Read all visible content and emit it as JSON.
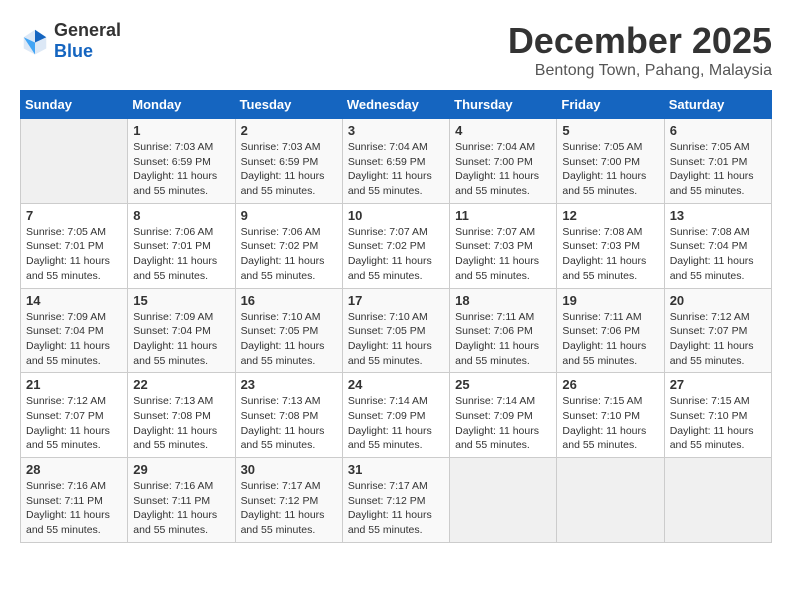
{
  "logo": {
    "text_general": "General",
    "text_blue": "Blue"
  },
  "title": "December 2025",
  "subtitle": "Bentong Town, Pahang, Malaysia",
  "header": {
    "days": [
      "Sunday",
      "Monday",
      "Tuesday",
      "Wednesday",
      "Thursday",
      "Friday",
      "Saturday"
    ]
  },
  "weeks": [
    {
      "days": [
        {
          "num": "",
          "empty": true
        },
        {
          "num": "1",
          "sunrise": "Sunrise: 7:03 AM",
          "sunset": "Sunset: 6:59 PM",
          "daylight": "Daylight: 11 hours and 55 minutes."
        },
        {
          "num": "2",
          "sunrise": "Sunrise: 7:03 AM",
          "sunset": "Sunset: 6:59 PM",
          "daylight": "Daylight: 11 hours and 55 minutes."
        },
        {
          "num": "3",
          "sunrise": "Sunrise: 7:04 AM",
          "sunset": "Sunset: 6:59 PM",
          "daylight": "Daylight: 11 hours and 55 minutes."
        },
        {
          "num": "4",
          "sunrise": "Sunrise: 7:04 AM",
          "sunset": "Sunset: 7:00 PM",
          "daylight": "Daylight: 11 hours and 55 minutes."
        },
        {
          "num": "5",
          "sunrise": "Sunrise: 7:05 AM",
          "sunset": "Sunset: 7:00 PM",
          "daylight": "Daylight: 11 hours and 55 minutes."
        },
        {
          "num": "6",
          "sunrise": "Sunrise: 7:05 AM",
          "sunset": "Sunset: 7:01 PM",
          "daylight": "Daylight: 11 hours and 55 minutes."
        }
      ]
    },
    {
      "days": [
        {
          "num": "7",
          "sunrise": "Sunrise: 7:05 AM",
          "sunset": "Sunset: 7:01 PM",
          "daylight": "Daylight: 11 hours and 55 minutes."
        },
        {
          "num": "8",
          "sunrise": "Sunrise: 7:06 AM",
          "sunset": "Sunset: 7:01 PM",
          "daylight": "Daylight: 11 hours and 55 minutes."
        },
        {
          "num": "9",
          "sunrise": "Sunrise: 7:06 AM",
          "sunset": "Sunset: 7:02 PM",
          "daylight": "Daylight: 11 hours and 55 minutes."
        },
        {
          "num": "10",
          "sunrise": "Sunrise: 7:07 AM",
          "sunset": "Sunset: 7:02 PM",
          "daylight": "Daylight: 11 hours and 55 minutes."
        },
        {
          "num": "11",
          "sunrise": "Sunrise: 7:07 AM",
          "sunset": "Sunset: 7:03 PM",
          "daylight": "Daylight: 11 hours and 55 minutes."
        },
        {
          "num": "12",
          "sunrise": "Sunrise: 7:08 AM",
          "sunset": "Sunset: 7:03 PM",
          "daylight": "Daylight: 11 hours and 55 minutes."
        },
        {
          "num": "13",
          "sunrise": "Sunrise: 7:08 AM",
          "sunset": "Sunset: 7:04 PM",
          "daylight": "Daylight: 11 hours and 55 minutes."
        }
      ]
    },
    {
      "days": [
        {
          "num": "14",
          "sunrise": "Sunrise: 7:09 AM",
          "sunset": "Sunset: 7:04 PM",
          "daylight": "Daylight: 11 hours and 55 minutes."
        },
        {
          "num": "15",
          "sunrise": "Sunrise: 7:09 AM",
          "sunset": "Sunset: 7:04 PM",
          "daylight": "Daylight: 11 hours and 55 minutes."
        },
        {
          "num": "16",
          "sunrise": "Sunrise: 7:10 AM",
          "sunset": "Sunset: 7:05 PM",
          "daylight": "Daylight: 11 hours and 55 minutes."
        },
        {
          "num": "17",
          "sunrise": "Sunrise: 7:10 AM",
          "sunset": "Sunset: 7:05 PM",
          "daylight": "Daylight: 11 hours and 55 minutes."
        },
        {
          "num": "18",
          "sunrise": "Sunrise: 7:11 AM",
          "sunset": "Sunset: 7:06 PM",
          "daylight": "Daylight: 11 hours and 55 minutes."
        },
        {
          "num": "19",
          "sunrise": "Sunrise: 7:11 AM",
          "sunset": "Sunset: 7:06 PM",
          "daylight": "Daylight: 11 hours and 55 minutes."
        },
        {
          "num": "20",
          "sunrise": "Sunrise: 7:12 AM",
          "sunset": "Sunset: 7:07 PM",
          "daylight": "Daylight: 11 hours and 55 minutes."
        }
      ]
    },
    {
      "days": [
        {
          "num": "21",
          "sunrise": "Sunrise: 7:12 AM",
          "sunset": "Sunset: 7:07 PM",
          "daylight": "Daylight: 11 hours and 55 minutes."
        },
        {
          "num": "22",
          "sunrise": "Sunrise: 7:13 AM",
          "sunset": "Sunset: 7:08 PM",
          "daylight": "Daylight: 11 hours and 55 minutes."
        },
        {
          "num": "23",
          "sunrise": "Sunrise: 7:13 AM",
          "sunset": "Sunset: 7:08 PM",
          "daylight": "Daylight: 11 hours and 55 minutes."
        },
        {
          "num": "24",
          "sunrise": "Sunrise: 7:14 AM",
          "sunset": "Sunset: 7:09 PM",
          "daylight": "Daylight: 11 hours and 55 minutes."
        },
        {
          "num": "25",
          "sunrise": "Sunrise: 7:14 AM",
          "sunset": "Sunset: 7:09 PM",
          "daylight": "Daylight: 11 hours and 55 minutes."
        },
        {
          "num": "26",
          "sunrise": "Sunrise: 7:15 AM",
          "sunset": "Sunset: 7:10 PM",
          "daylight": "Daylight: 11 hours and 55 minutes."
        },
        {
          "num": "27",
          "sunrise": "Sunrise: 7:15 AM",
          "sunset": "Sunset: 7:10 PM",
          "daylight": "Daylight: 11 hours and 55 minutes."
        }
      ]
    },
    {
      "days": [
        {
          "num": "28",
          "sunrise": "Sunrise: 7:16 AM",
          "sunset": "Sunset: 7:11 PM",
          "daylight": "Daylight: 11 hours and 55 minutes."
        },
        {
          "num": "29",
          "sunrise": "Sunrise: 7:16 AM",
          "sunset": "Sunset: 7:11 PM",
          "daylight": "Daylight: 11 hours and 55 minutes."
        },
        {
          "num": "30",
          "sunrise": "Sunrise: 7:17 AM",
          "sunset": "Sunset: 7:12 PM",
          "daylight": "Daylight: 11 hours and 55 minutes."
        },
        {
          "num": "31",
          "sunrise": "Sunrise: 7:17 AM",
          "sunset": "Sunset: 7:12 PM",
          "daylight": "Daylight: 11 hours and 55 minutes."
        },
        {
          "num": "",
          "empty": true
        },
        {
          "num": "",
          "empty": true
        },
        {
          "num": "",
          "empty": true
        }
      ]
    }
  ]
}
